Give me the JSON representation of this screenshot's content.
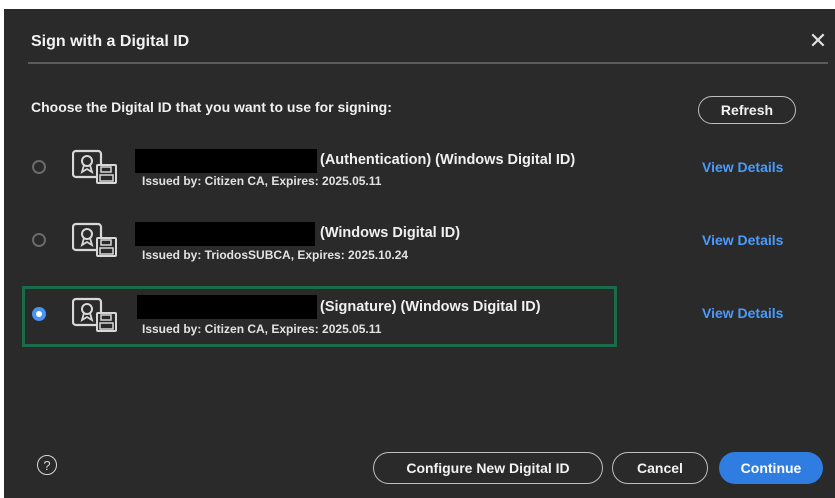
{
  "dialog": {
    "title": "Sign with a Digital ID",
    "close_icon": "close-icon",
    "prompt": "Choose the Digital ID that you want to use for signing:",
    "refresh_label": "Refresh"
  },
  "ids": [
    {
      "name": "(Authentication) (Windows Digital ID)",
      "issuer": "Issued by: Citizen CA, Expires: 2025.05.11",
      "details_label": "View Details",
      "selected": false
    },
    {
      "name": "(Windows Digital ID)",
      "issuer": "Issued by: TriodosSUBCA, Expires: 2025.10.24",
      "details_label": "View Details",
      "selected": false
    },
    {
      "name": "(Signature) (Windows Digital ID)",
      "issuer": "Issued by: Citizen CA, Expires: 2025.05.11",
      "details_label": "View Details",
      "selected": true
    }
  ],
  "footer": {
    "help_label": "?",
    "configure_label": "Configure New Digital ID",
    "cancel_label": "Cancel",
    "continue_label": "Continue"
  },
  "colors": {
    "background": "#2a2a2a",
    "link": "#4b9bff",
    "accent": "#2f7de0",
    "selection_border": "#1a6b49"
  }
}
